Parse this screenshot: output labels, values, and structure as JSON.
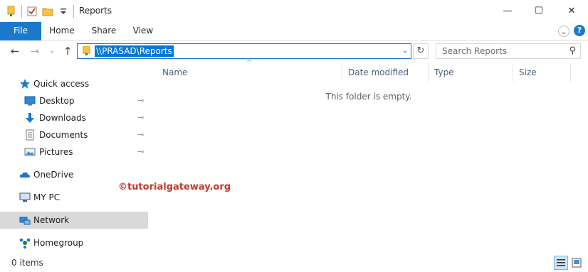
{
  "window": {
    "title": "Reports",
    "minimize_glyph": "—",
    "maximize_glyph": "☐",
    "close_glyph": "✕"
  },
  "ribbon": {
    "tabs": [
      "File",
      "Home",
      "Share",
      "View"
    ],
    "expand_glyph": "⌄",
    "help_glyph": "?"
  },
  "navigation": {
    "back_glyph": "←",
    "forward_glyph": "→",
    "recent_glyph": "⌄",
    "up_glyph": "↑",
    "address": "\\\\PRASAD\\Reports",
    "address_drop_glyph": "⌄",
    "refresh_glyph": "↻",
    "search_placeholder": "Search Reports",
    "search_glyph": "⚲"
  },
  "sidebar": {
    "items": [
      {
        "label": "Quick access",
        "icon": "star-icon"
      },
      {
        "label": "Desktop",
        "icon": "desktop-icon",
        "pinned": true
      },
      {
        "label": "Downloads",
        "icon": "download-icon",
        "pinned": true
      },
      {
        "label": "Documents",
        "icon": "documents-icon",
        "pinned": true
      },
      {
        "label": "Pictures",
        "icon": "pictures-icon",
        "pinned": true
      },
      {
        "label": "OneDrive",
        "icon": "cloud-icon"
      },
      {
        "label": "MY PC",
        "icon": "computer-icon"
      },
      {
        "label": "Network",
        "icon": "network-icon",
        "selected": true
      },
      {
        "label": "Homegroup",
        "icon": "homegroup-icon"
      }
    ],
    "pin_glyph": "📌"
  },
  "file_list": {
    "columns": [
      "Name",
      "Date modified",
      "Type",
      "Size"
    ],
    "sort_glyph": "^",
    "empty_message": "This folder is empty."
  },
  "watermark": "©tutorialgateway.org",
  "status": {
    "items_count": "0 items"
  },
  "colors": {
    "accent": "#1979ca",
    "selection": "#0078d7",
    "folder": "#f5c542",
    "watermark": "#c0392b"
  }
}
